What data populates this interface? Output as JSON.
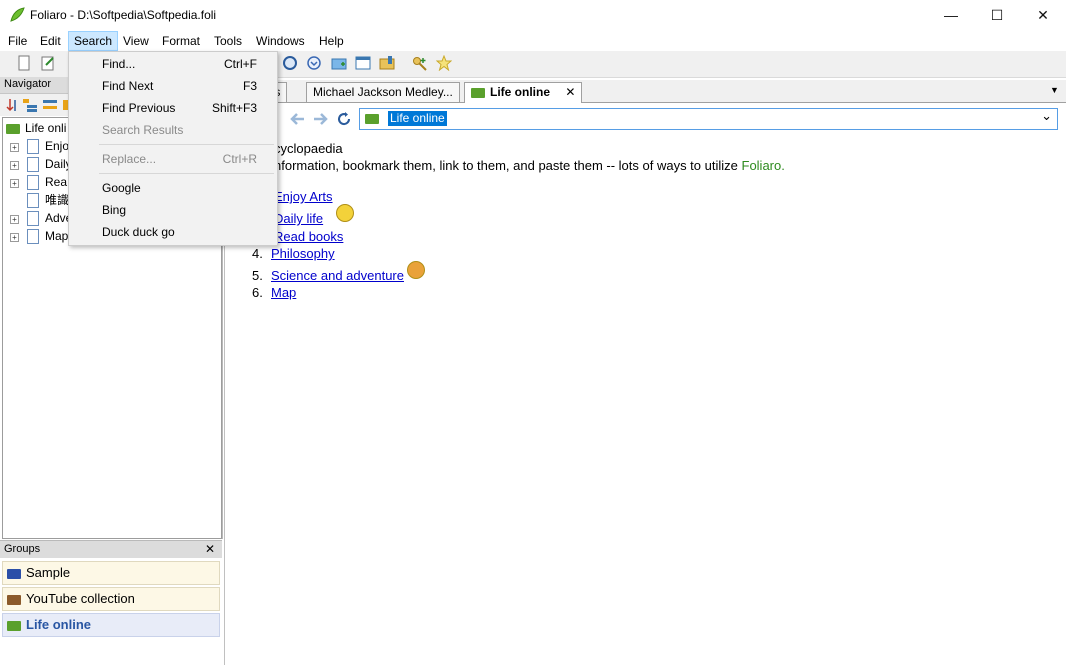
{
  "window": {
    "title": "Foliaro - D:\\Softpedia\\Softpedia.foli",
    "minimize": "—",
    "maximize": "☐",
    "close": "✕"
  },
  "menubar": {
    "items": [
      "File",
      "Edit",
      "Search",
      "View",
      "Format",
      "Tools",
      "Windows",
      "Help"
    ],
    "active": "Search"
  },
  "search_menu": {
    "items": [
      {
        "label": "Find...",
        "shortcut": "Ctrl+F"
      },
      {
        "label": "Find Next",
        "shortcut": "F3"
      },
      {
        "label": "Find Previous",
        "shortcut": "Shift+F3"
      },
      {
        "label": "Search Results",
        "shortcut": ""
      },
      {
        "label": "Replace...",
        "shortcut": "Ctrl+R"
      },
      {
        "label": "Google",
        "shortcut": ""
      },
      {
        "label": "Bing",
        "shortcut": ""
      },
      {
        "label": "Duck duck go",
        "shortcut": ""
      }
    ]
  },
  "navigator": {
    "title": "Navigator",
    "tree": [
      {
        "label": "Life onli"
      },
      {
        "label": "Enjo"
      },
      {
        "label": "Daily"
      },
      {
        "label": "Rea"
      },
      {
        "label": "唯識"
      },
      {
        "label": "Adve"
      },
      {
        "label": "Map"
      }
    ]
  },
  "groups": {
    "title": "Groups",
    "close": "✕",
    "items": [
      {
        "label": "Sample",
        "color": "#2b4fa8"
      },
      {
        "label": "YouTube collection",
        "color": "#8b5a2b"
      },
      {
        "label": "Life online",
        "color": "#5aa02c"
      }
    ]
  },
  "tabs": {
    "items": [
      "ges",
      "Michael Jackson Medley...",
      "Life online"
    ],
    "active": "Life online",
    "close": "✕",
    "overflow": "▼"
  },
  "address": {
    "value": "Life online",
    "dropdown": "⌄"
  },
  "content": {
    "heading_fragment": "cyclopaedia",
    "intro": "nformation, bookmark them, link to them, and paste them -- lots of ways to utilize",
    "brand": "Foliaro.",
    "list": [
      {
        "num": "",
        "label": "Enjoy Arts"
      },
      {
        "num": "",
        "label": "Daily life"
      },
      {
        "num": "",
        "label": "Read books"
      },
      {
        "num": "4.",
        "label": "Philosophy"
      },
      {
        "num": "5.",
        "label": "Science and adventure"
      },
      {
        "num": "6.",
        "label": "Map"
      }
    ]
  },
  "colors": {
    "accent": "#0078d7",
    "menu_highlight": "#cce8ff",
    "link": "#0000cc",
    "brand_green": "#2e8b1e"
  }
}
